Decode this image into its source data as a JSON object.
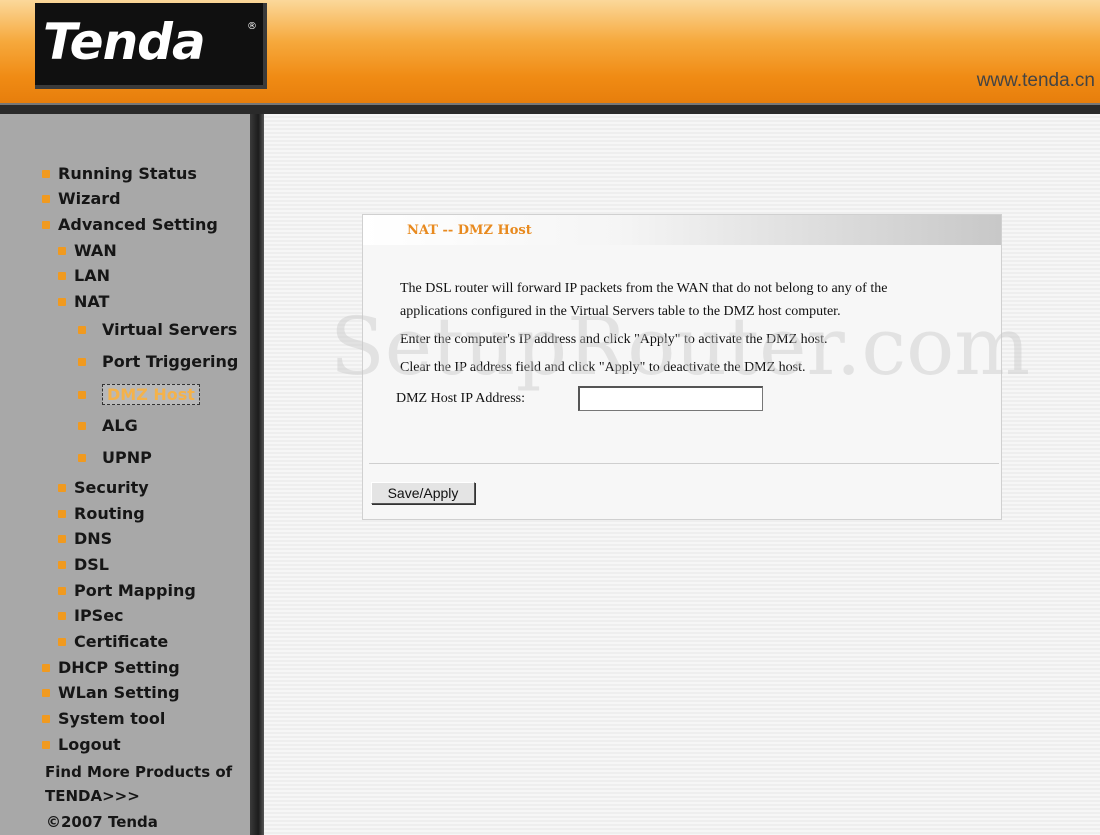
{
  "header": {
    "logo_text": "Tenda",
    "logo_reg": "®",
    "site_url": "www.tenda.cn"
  },
  "sidebar": {
    "items": [
      {
        "label": "Running Status"
      },
      {
        "label": "Wizard"
      },
      {
        "label": "Advanced Setting"
      },
      {
        "label": "WAN"
      },
      {
        "label": "LAN"
      },
      {
        "label": "NAT"
      },
      {
        "label": "Virtual Servers"
      },
      {
        "label": "Port Triggering"
      },
      {
        "label": "DMZ Host"
      },
      {
        "label": "ALG"
      },
      {
        "label": "UPNP"
      },
      {
        "label": "Security"
      },
      {
        "label": "Routing"
      },
      {
        "label": "DNS"
      },
      {
        "label": "DSL"
      },
      {
        "label": "Port Mapping"
      },
      {
        "label": "IPSec"
      },
      {
        "label": "Certificate"
      },
      {
        "label": "DHCP Setting"
      },
      {
        "label": "WLan Setting"
      },
      {
        "label": "System tool"
      },
      {
        "label": "Logout"
      }
    ],
    "find_more": "Find More Products of TENDA>>>",
    "copyright": "©2007 Tenda"
  },
  "panel": {
    "title": "NAT -- DMZ Host",
    "desc_line1": "The DSL router will forward IP packets from the WAN that do not belong to any of the",
    "desc_line2": "applications configured in the Virtual Servers table to the DMZ host computer.",
    "desc_line3": "Enter the computer's IP address and click \"Apply\" to activate the DMZ host.",
    "desc_line4": "Clear the IP address field and click \"Apply\" to deactivate the DMZ host.",
    "field_label": "DMZ Host IP Address:",
    "ip_value": "",
    "save_label": "Save/Apply"
  },
  "watermark": "SetupRouter.com",
  "colors": {
    "accent": "#e88a1f",
    "bullet": "#f09a20",
    "sidebar_bg": "#a8a8a8"
  }
}
